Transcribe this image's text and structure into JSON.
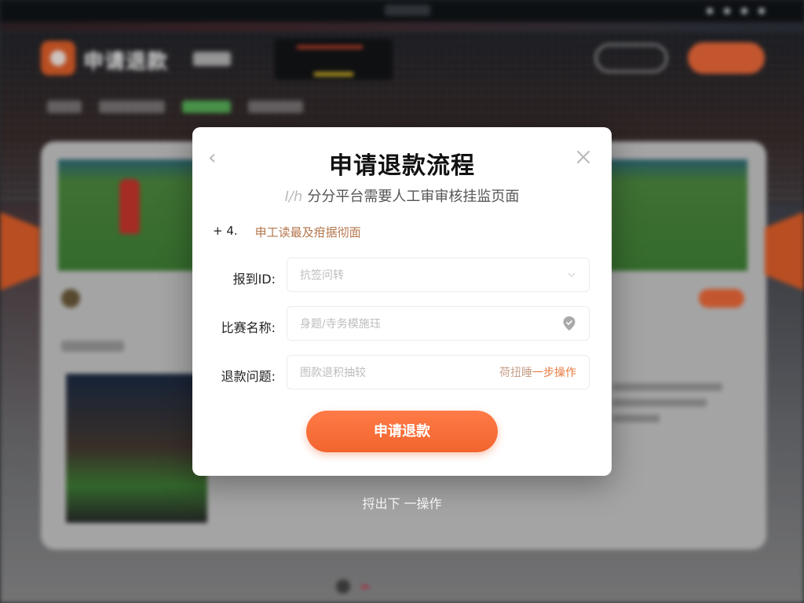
{
  "background": {
    "app_title": "申请退款",
    "accent_color": "#ef6a3a"
  },
  "modal": {
    "title": "申请退款流程",
    "subtitle_prefix": "Ⅰ/h",
    "subtitle": "分分平台需要人工审审核挂监页面",
    "step_number": "+ 4.",
    "step_text": "申工读最及疳据彻面",
    "back_icon": "chevron-left-icon",
    "close_icon": "close-icon",
    "fields": [
      {
        "label": "报到ID:",
        "placeholder": "抗签问转",
        "suffix_icon": "chevron-down-icon"
      },
      {
        "label": "比赛名称:",
        "placeholder": "身题/寺务模施珏",
        "suffix_icon": "map-pin-icon"
      },
      {
        "label": "退款问题:",
        "placeholder": "图款退积抽较",
        "suffix_muted": "荷扭睡",
        "suffix_link": "一步操作"
      }
    ],
    "submit_label": "申请退款"
  },
  "below_link": "捋出下 一操作"
}
